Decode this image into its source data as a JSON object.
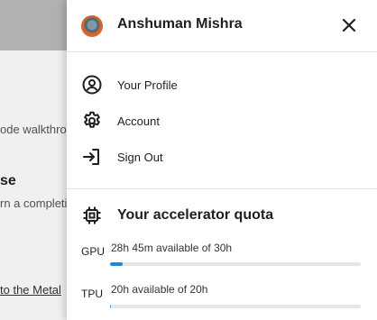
{
  "background": {
    "walkthrough_text": "ode walkthro",
    "section_heading": "se",
    "completion_text": "rn a completi",
    "link_text": "to the Metal"
  },
  "panel": {
    "user_name": "Anshuman Mishra",
    "close_icon": "close-icon",
    "menu": [
      {
        "label": "Your Profile",
        "icon": "account-circle-icon"
      },
      {
        "label": "Account",
        "icon": "gear-icon"
      },
      {
        "label": "Sign Out",
        "icon": "sign-out-icon"
      }
    ],
    "quota": {
      "title": "Your accelerator quota",
      "icon": "chip-icon",
      "items": [
        {
          "label": "GPU",
          "text": "28h 45m available of 30h",
          "fill_fraction": 0.05
        },
        {
          "label": "TPU",
          "text": "20h available of 20h",
          "fill_fraction": 0.005
        }
      ]
    }
  },
  "colors": {
    "accent": "#1a8bdb",
    "track": "#e3e6ea"
  }
}
